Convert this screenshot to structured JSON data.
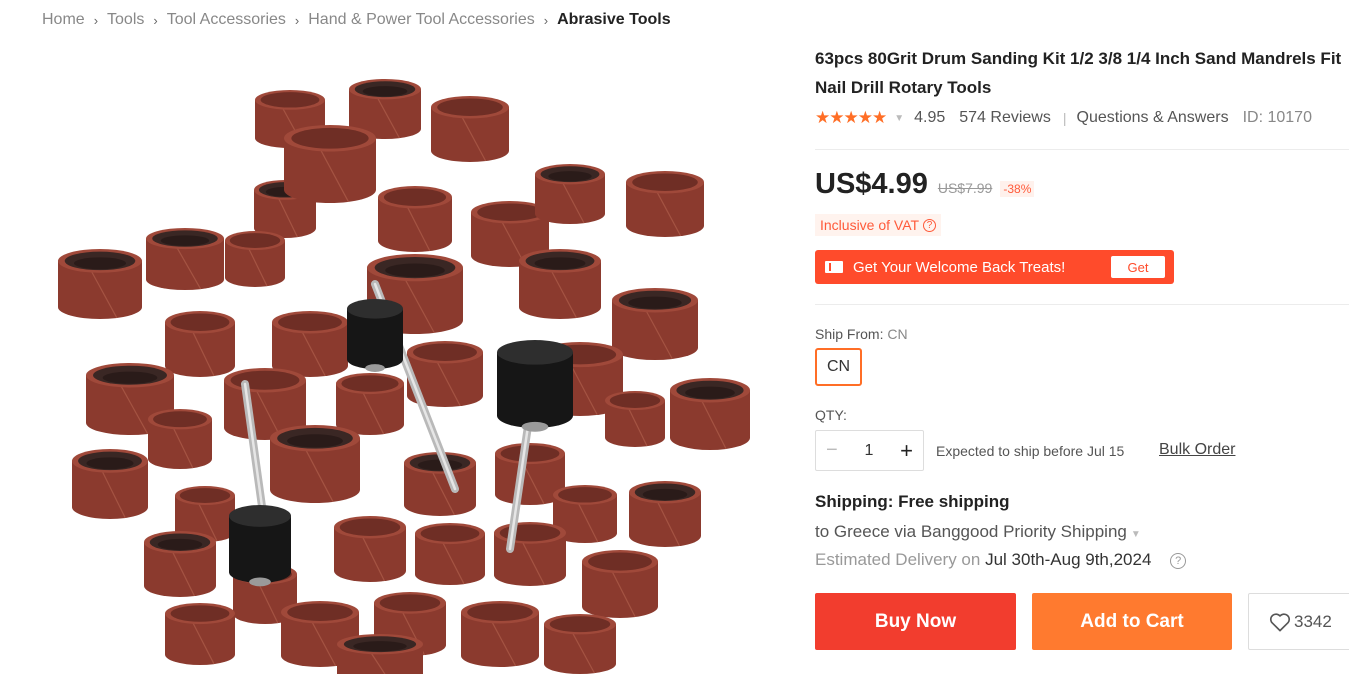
{
  "breadcrumb": {
    "items": [
      "Home",
      "Tools",
      "Tool Accessories",
      "Hand & Power Tool Accessories"
    ],
    "current": "Abrasive Tools"
  },
  "product": {
    "title": "63pcs 80Grit Drum Sanding Kit 1/2 3/8 1/4 Inch Sand Mandrels Fit Nail Drill Rotary Tools",
    "stars": "★★★★★",
    "rating": "4.95",
    "reviews": "574 Reviews",
    "qa_link": "Questions & Answers",
    "id_text": "ID: 10170"
  },
  "price": {
    "current": "US$4.99",
    "original": "US$7.99",
    "discount": "-38%",
    "vat": "Inclusive of VAT"
  },
  "promo": {
    "text": "Get Your Welcome Back Treats!",
    "button": "Get"
  },
  "ship_from": {
    "label": "Ship From:",
    "value": "CN",
    "option": "CN"
  },
  "qty": {
    "label": "QTY:",
    "value": "1",
    "minus": "−",
    "plus": "+",
    "expected": "Expected to ship before Jul 15",
    "bulk": "Bulk Order"
  },
  "shipping": {
    "title": "Shipping: Free shipping",
    "to": "to Greece via Banggood Priority Shipping",
    "delivery_prefix": "Estimated Delivery on",
    "delivery_date": "Jul 30th-Aug 9th,2024"
  },
  "actions": {
    "buy_now": "Buy Now",
    "add_to_cart": "Add to Cart",
    "wishlist_count": "3342"
  },
  "colors": {
    "accent": "#ff6e26",
    "buy": "#f23d2e",
    "cart": "#ff7a2f",
    "sanding_band": "#8b3a2e"
  }
}
